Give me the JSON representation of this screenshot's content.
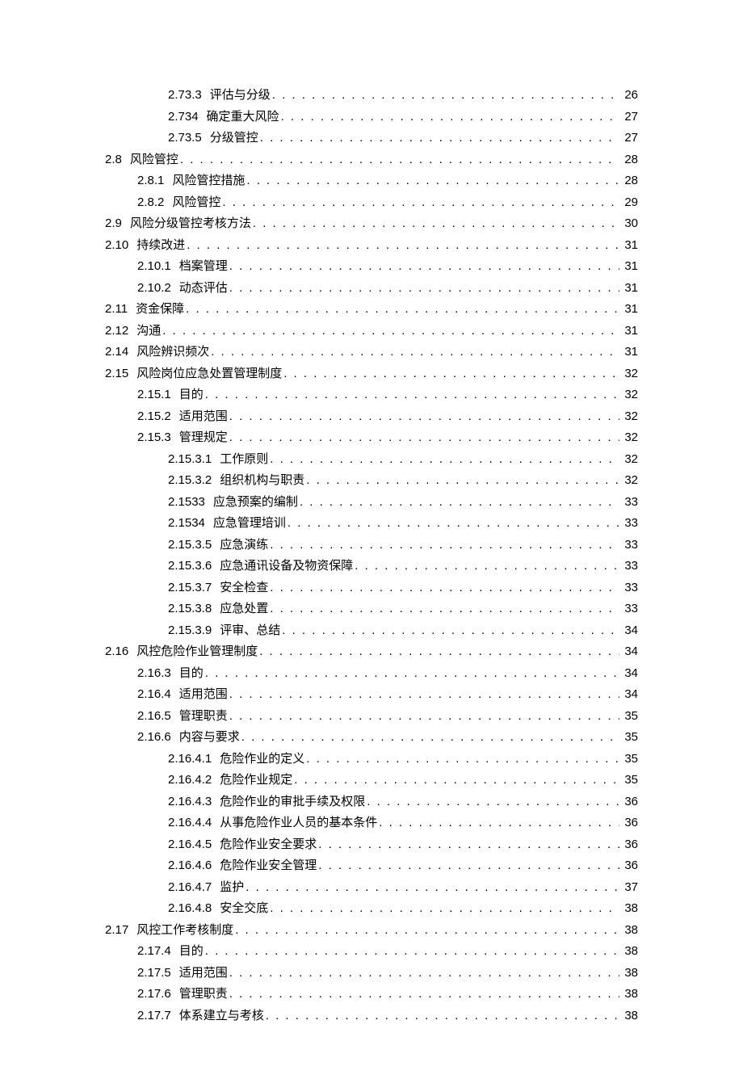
{
  "toc": [
    {
      "indent": 2,
      "num": "2.73.3",
      "title": "评估与分级",
      "page": "26"
    },
    {
      "indent": 2,
      "num": "2.734",
      "title": "确定重大风险",
      "page": "27"
    },
    {
      "indent": 2,
      "num": "2.73.5",
      "title": "分级管控",
      "page": "27"
    },
    {
      "indent": 0,
      "num": "2.8",
      "title": "风险管控",
      "page": "28"
    },
    {
      "indent": 1,
      "num": "2.8.1",
      "title": "风险管控措施",
      "page": "28"
    },
    {
      "indent": 1,
      "num": "2.8.2",
      "title": "风险管控",
      "page": "29"
    },
    {
      "indent": 0,
      "num": "2.9",
      "title": "风险分级管控考核方法",
      "page": "30"
    },
    {
      "indent": 0,
      "num": "2.10",
      "title": "持续改进",
      "page": "31"
    },
    {
      "indent": 1,
      "num": "2.10.1",
      "title": "档案管理",
      "page": "31"
    },
    {
      "indent": 1,
      "num": "2.10.2",
      "title": "动态评估",
      "page": "31"
    },
    {
      "indent": 0,
      "num": "2.11",
      "title": "资金保障",
      "page": "31"
    },
    {
      "indent": 0,
      "num": "2.12",
      "title": "沟通",
      "page": "31"
    },
    {
      "indent": 0,
      "num": "2.14",
      "title": "风险辨识频次",
      "page": "31"
    },
    {
      "indent": 0,
      "num": "2.15",
      "title": "风险岗位应急处置管理制度",
      "page": "32"
    },
    {
      "indent": 1,
      "num": "2.15.1",
      "title": "目的",
      "page": "32"
    },
    {
      "indent": 1,
      "num": "2.15.2",
      "title": "适用范围",
      "page": "32"
    },
    {
      "indent": 1,
      "num": "2.15.3",
      "title": "管理规定",
      "page": "32"
    },
    {
      "indent": 2,
      "num": "2.15.3.1",
      "title": "工作原则",
      "page": "32"
    },
    {
      "indent": 2,
      "num": "2.15.3.2",
      "title": "组织机构与职责",
      "page": "32"
    },
    {
      "indent": 2,
      "num": "2.1533",
      "title": "应急预案的编制",
      "page": "33"
    },
    {
      "indent": 2,
      "num": "2.1534",
      "title": "应急管理培训",
      "page": "33"
    },
    {
      "indent": 2,
      "num": "2.15.3.5",
      "title": "应急演练",
      "page": "33"
    },
    {
      "indent": 2,
      "num": "2.15.3.6",
      "title": "应急通讯设备及物资保障",
      "page": "33"
    },
    {
      "indent": 2,
      "num": "2.15.3.7",
      "title": "安全检查",
      "page": "33"
    },
    {
      "indent": 2,
      "num": "2.15.3.8",
      "title": "应急处置",
      "page": "33"
    },
    {
      "indent": 2,
      "num": "2.15.3.9",
      "title": "评审、总结",
      "page": "34"
    },
    {
      "indent": 0,
      "num": "2.16",
      "title": "风控危险作业管理制度",
      "page": "34"
    },
    {
      "indent": 1,
      "num": "2.16.3",
      "title": "目的",
      "page": "34"
    },
    {
      "indent": 1,
      "num": "2.16.4",
      "title": "适用范围",
      "page": "34"
    },
    {
      "indent": 1,
      "num": "2.16.5",
      "title": "管理职责",
      "page": "35"
    },
    {
      "indent": 1,
      "num": "2.16.6",
      "title": "内容与要求",
      "page": "35"
    },
    {
      "indent": 2,
      "num": "2.16.4.1",
      "title": "危险作业的定义",
      "page": "35"
    },
    {
      "indent": 2,
      "num": "2.16.4.2",
      "title": "危险作业规定",
      "page": "35"
    },
    {
      "indent": 2,
      "num": "2.16.4.3",
      "title": "危险作业的审批手续及权限",
      "page": "36"
    },
    {
      "indent": 2,
      "num": "2.16.4.4",
      "title": "从事危险作业人员的基本条件",
      "page": "36"
    },
    {
      "indent": 2,
      "num": "2.16.4.5",
      "title": "危险作业安全要求",
      "page": "36"
    },
    {
      "indent": 2,
      "num": "2.16.4.6",
      "title": "危险作业安全管理",
      "page": "36"
    },
    {
      "indent": 2,
      "num": "2.16.4.7",
      "title": "监护",
      "page": "37"
    },
    {
      "indent": 2,
      "num": "2.16.4.8",
      "title": "安全交底",
      "page": "38"
    },
    {
      "indent": 0,
      "num": "2.17",
      "title": "风控工作考核制度",
      "page": "38"
    },
    {
      "indent": 1,
      "num": "2.17.4",
      "title": "目的",
      "page": "38"
    },
    {
      "indent": 1,
      "num": "2.17.5",
      "title": "适用范围",
      "page": "38"
    },
    {
      "indent": 1,
      "num": "2.17.6",
      "title": "管理职责",
      "page": "38"
    },
    {
      "indent": 1,
      "num": "2.17.7",
      "title": "体系建立与考核",
      "page": "38"
    }
  ]
}
